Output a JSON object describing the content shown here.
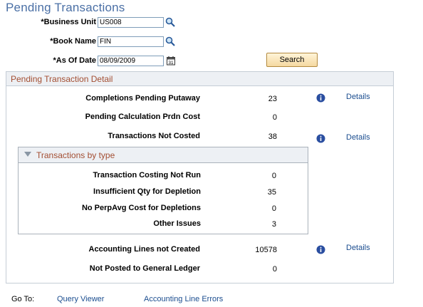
{
  "page": {
    "title": "Pending Transactions"
  },
  "form": {
    "business_unit": {
      "label": "*Business Unit",
      "value": "US008"
    },
    "book_name": {
      "label": "*Book Name",
      "value": "FIN"
    },
    "as_of_date": {
      "label": "*As Of Date",
      "value": "08/09/2009"
    },
    "search_label": "Search"
  },
  "detail": {
    "title": "Pending Transaction Detail",
    "rows": [
      {
        "label": "Completions Pending Putaway",
        "value": "23",
        "link": "Details"
      },
      {
        "label": "Pending Calculation Prdn Cost",
        "value": "0"
      },
      {
        "label": "Transactions Not Costed",
        "value": "38",
        "link": "Details"
      }
    ],
    "by_type": {
      "title": "Transactions by type",
      "rows": [
        {
          "label": "Transaction Costing Not Run",
          "value": "0"
        },
        {
          "label": "Insufficient Qty for Depletion",
          "value": "35"
        },
        {
          "label": "No PerpAvg Cost for Depletions",
          "value": "0"
        },
        {
          "label": "Other Issues",
          "value": "3"
        }
      ]
    },
    "bottom_rows": [
      {
        "label": "Accounting Lines not Created",
        "value": "10578",
        "link": "Details"
      },
      {
        "label": "Not Posted to General Ledger",
        "value": "0"
      }
    ]
  },
  "footer": {
    "goto_label": "Go To:",
    "links": [
      "Query Viewer",
      "Accounting Line Errors"
    ]
  },
  "icons": {
    "lookup": "magnifier-icon",
    "calendar": "calendar-icon",
    "info": "info-icon",
    "collapse": "triangle-down-icon"
  },
  "colors": {
    "title": "#4a6fa5",
    "section_title": "#a34e32",
    "link": "#1b4d8f",
    "info": "#2a4ea0"
  }
}
